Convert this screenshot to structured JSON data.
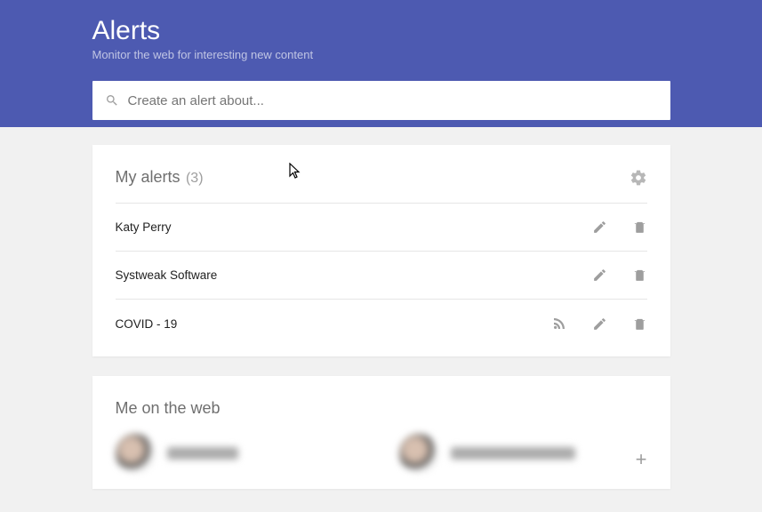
{
  "header": {
    "title": "Alerts",
    "subtitle": "Monitor the web for interesting new content",
    "search_placeholder": "Create an alert about..."
  },
  "my_alerts": {
    "title": "My alerts",
    "count_label": "(3)",
    "items": [
      {
        "name": "Katy Perry",
        "has_rss": false
      },
      {
        "name": "Systweak Software",
        "has_rss": false
      },
      {
        "name": "COVID - 19",
        "has_rss": true
      }
    ]
  },
  "me_on_web": {
    "title": "Me on the web"
  },
  "icons": {
    "gear": "gear-icon",
    "edit": "edit-icon",
    "delete": "delete-icon",
    "rss": "rss-icon",
    "search": "search-icon",
    "add": "add-icon"
  }
}
